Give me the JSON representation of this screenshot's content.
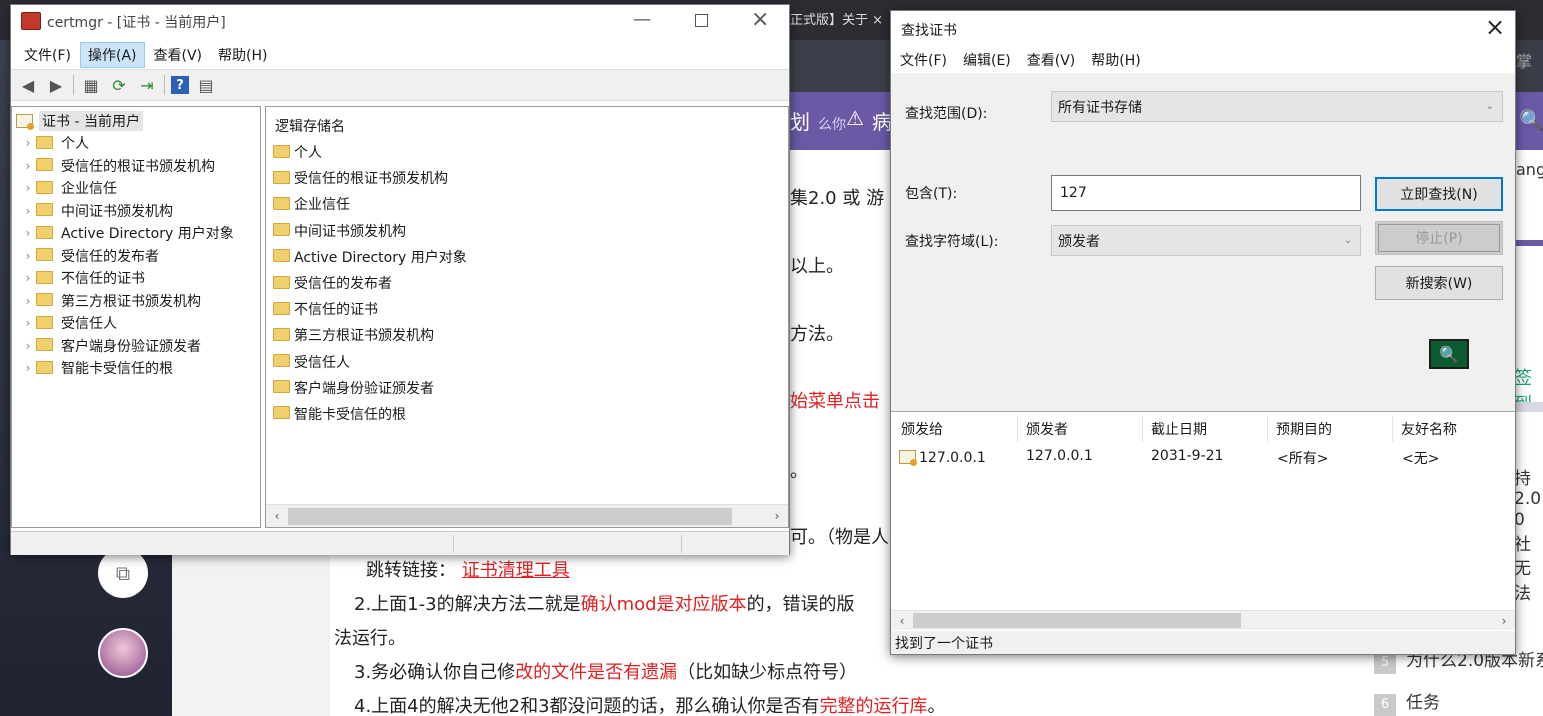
{
  "background": {
    "tab_text": "正式版】关于",
    "tab_close": "×",
    "nav_fragment": "划",
    "nav_fragment2": "么你",
    "nav_warning": "病",
    "article_lines": {
      "l1": "集2.0 或 游",
      "l2": "以上。",
      "l3": "方法。",
      "l4": "始菜单点击",
      "l5": "。",
      "l6": "可。（物是人",
      "l7_prefix": "跳转链接：",
      "l7_link": "证书清理工具",
      "l8_a": "2.上面1-3的解决方法二就是",
      "l8_b": "确认mod是对应版本",
      "l8_c": "的，错误的版",
      "l9": "法运行。",
      "l10_a": "3.务必确认你自己修",
      "l10_b": "改的文件是否有遗漏",
      "l10_c": "（比如缺少标点符号）",
      "l11_a": "4.上面4的解决无他2和3都没问题的话，那么确认你是否有",
      "l11_b": "完整的运行库",
      "l11_c": "。"
    },
    "right_fragments": {
      "r1": "掌握",
      "r2": "ang",
      "r3": "签到",
      "r4": "持2.0",
      "r5": "0 社",
      "r6": "无法",
      "r7": "为什么2.0版本新系",
      "r8_num": "6",
      "r8_text": "任务",
      "r7_num": "5"
    }
  },
  "certmgr": {
    "title": "certmgr - [证书 - 当前用户]",
    "menu": [
      "文件(F)",
      "操作(A)",
      "查看(V)",
      "帮助(H)"
    ],
    "tree_root": "证书 - 当前用户",
    "tree_items": [
      "个人",
      "受信任的根证书颁发机构",
      "企业信任",
      "中间证书颁发机构",
      "Active Directory 用户对象",
      "受信任的发布者",
      "不信任的证书",
      "第三方根证书颁发机构",
      "受信任人",
      "客户端身份验证颁发者",
      "智能卡受信任的根"
    ],
    "list_header": "逻辑存储名",
    "list_items": [
      "个人",
      "受信任的根证书颁发机构",
      "企业信任",
      "中间证书颁发机构",
      "Active Directory 用户对象",
      "受信任的发布者",
      "不信任的证书",
      "第三方根证书颁发机构",
      "受信任人",
      "客户端身份验证颁发者",
      "智能卡受信任的根"
    ]
  },
  "find_dialog": {
    "title": "查找证书",
    "close": "×",
    "menu": [
      "文件(F)",
      "编辑(E)",
      "查看(V)",
      "帮助(H)"
    ],
    "scope_label": "查找范围(D):",
    "scope_value": "所有证书存储",
    "contains_label": "包含(T):",
    "contains_value": "127",
    "field_label": "查找字符域(L):",
    "field_value": "颁发者",
    "btn_find": "立即查找(N)",
    "btn_stop": "停止(P)",
    "btn_new": "新搜索(W)",
    "columns": [
      "颁发给",
      "颁发者",
      "截止日期",
      "预期目的",
      "友好名称"
    ],
    "rows": [
      {
        "issued_to": "127.0.0.1",
        "issuer": "127.0.0.1",
        "expires": "2031-9-21",
        "purpose": "<所有>",
        "friendly": "<无>"
      }
    ],
    "status": "找到了一个证书"
  }
}
